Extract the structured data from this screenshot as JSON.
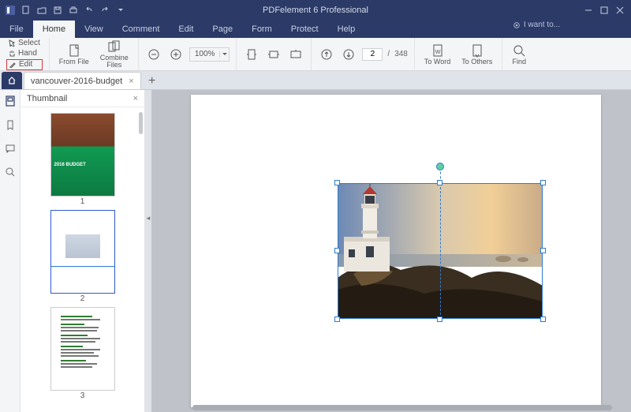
{
  "app": {
    "title": "PDFelement 6 Professional"
  },
  "menu": {
    "file": "File",
    "home": "Home",
    "view": "View",
    "comment": "Comment",
    "edit": "Edit",
    "page": "Page",
    "form": "Form",
    "protect": "Protect",
    "help": "Help",
    "iwant": "I want to..."
  },
  "ribbon": {
    "select": "Select",
    "hand": "Hand",
    "edit": "Edit",
    "from_file": "From File",
    "combine_files": "Combine\nFiles",
    "zoom_value": "100%",
    "page_current": "2",
    "page_sep": "/",
    "page_total": "348",
    "to_word": "To Word",
    "to_others": "To Others",
    "find": "Find"
  },
  "tabs": {
    "doc_name": "vancouver-2016-budget"
  },
  "thumbnail": {
    "title": "Thumbnail",
    "pages": [
      {
        "num": "1",
        "cover_text": "2016 BUDGET"
      },
      {
        "num": "2"
      },
      {
        "num": "3"
      }
    ]
  }
}
